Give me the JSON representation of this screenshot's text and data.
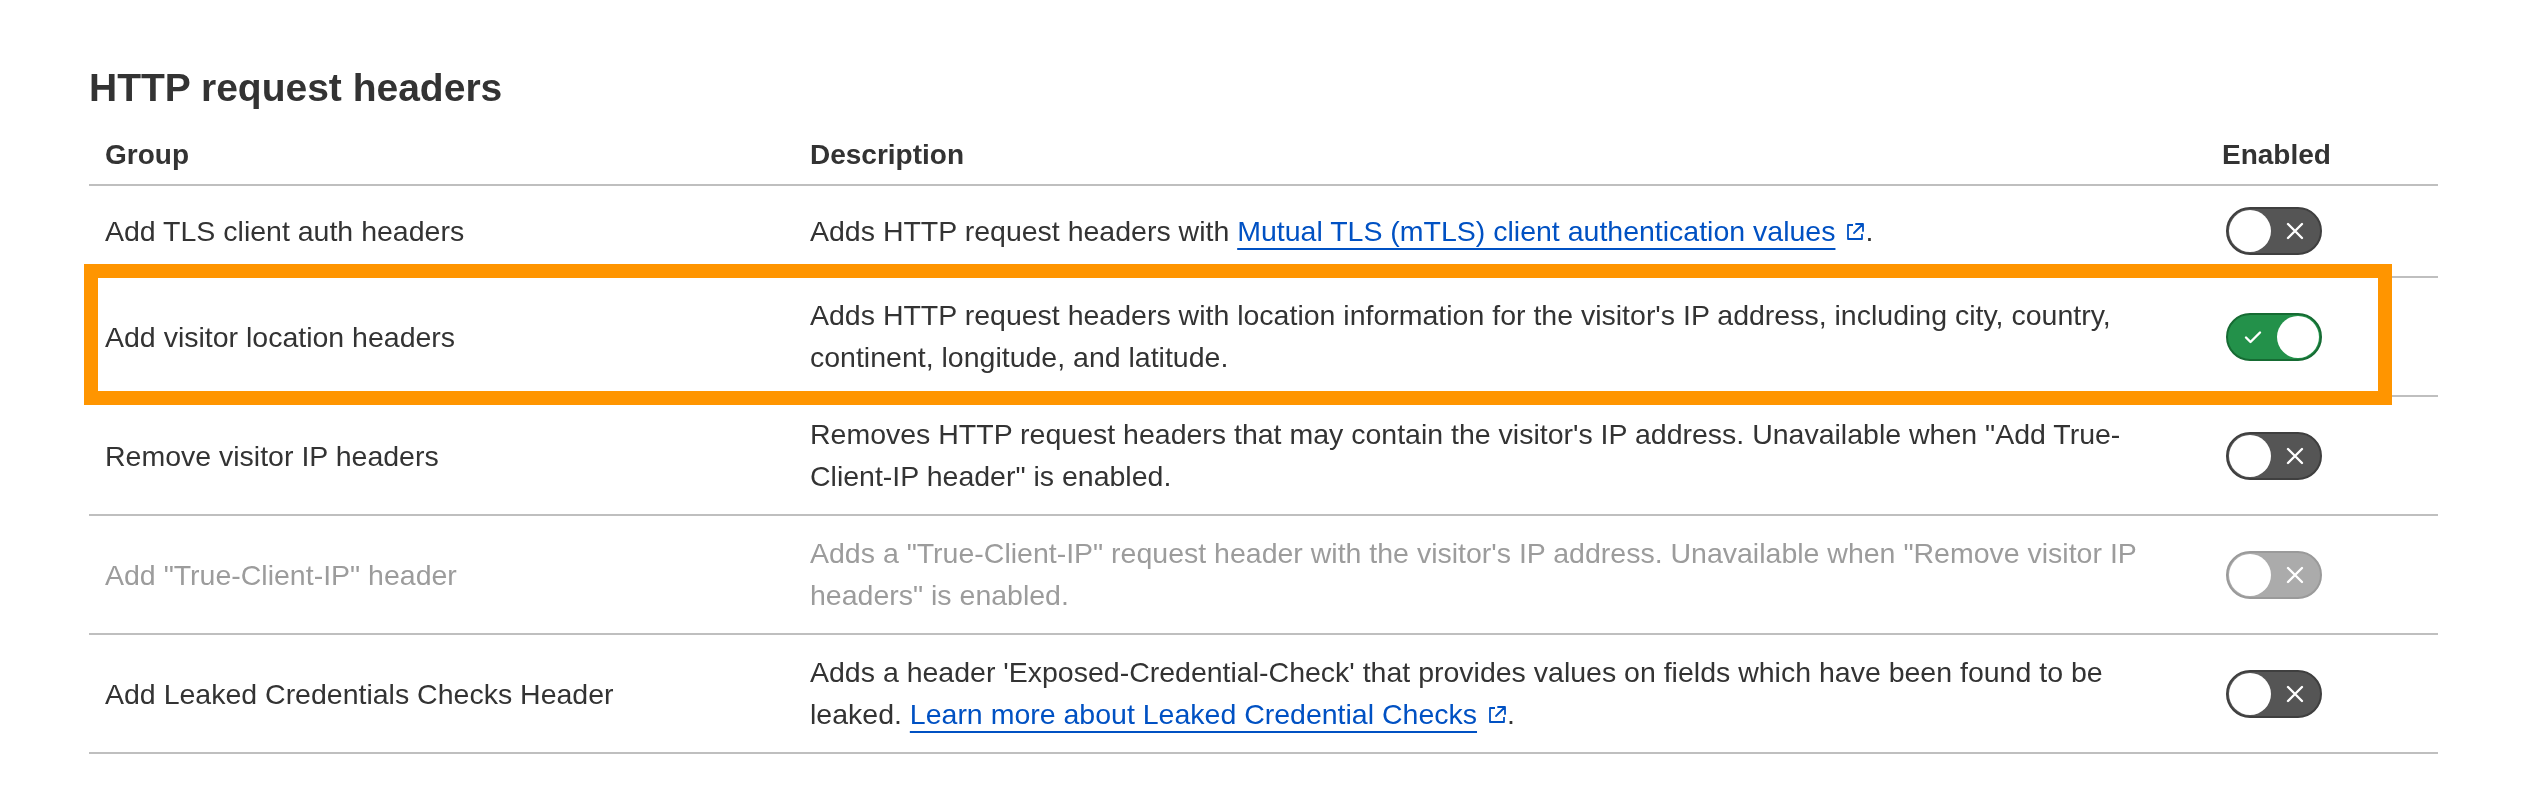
{
  "section": {
    "title": "HTTP request headers"
  },
  "table": {
    "columns": [
      "Group",
      "Description",
      "Enabled"
    ],
    "rows": [
      {
        "group": "Add TLS client auth headers",
        "description": [
          {
            "kind": "text",
            "text": "Adds HTTP request headers with "
          },
          {
            "kind": "link",
            "text": "Mutual TLS (mTLS) client authentication values",
            "external": true
          },
          {
            "kind": "text",
            "text": "."
          }
        ],
        "enabled": false,
        "disabled": false,
        "highlighted": false
      },
      {
        "group": "Add visitor location headers",
        "description": [
          {
            "kind": "text",
            "text": "Adds HTTP request headers with location information for the visitor's IP address, including city, country, continent, longitude, and latitude."
          }
        ],
        "enabled": true,
        "disabled": false,
        "highlighted": true
      },
      {
        "group": "Remove visitor IP headers",
        "description": [
          {
            "kind": "text",
            "text": "Removes HTTP request headers that may contain the visitor's IP address. Unavailable when \"Add True-Client-IP header\" is enabled."
          }
        ],
        "enabled": false,
        "disabled": false,
        "highlighted": false
      },
      {
        "group": "Add \"True-Client-IP\" header",
        "description": [
          {
            "kind": "text",
            "text": "Adds a \"True-Client-IP\" request header with the visitor's IP address. Unavailable when \"Remove visitor IP headers\" is enabled."
          }
        ],
        "enabled": false,
        "disabled": true,
        "highlighted": false
      },
      {
        "group": "Add Leaked Credentials Checks Header",
        "description": [
          {
            "kind": "text",
            "text": "Adds a header 'Exposed-Credential-Check' that provides values on fields which have been found to be leaked. "
          },
          {
            "kind": "link",
            "text": "Learn more about Leaked Credential Checks",
            "external": true
          },
          {
            "kind": "text",
            "text": "."
          }
        ],
        "enabled": false,
        "disabled": false,
        "highlighted": false
      }
    ]
  }
}
